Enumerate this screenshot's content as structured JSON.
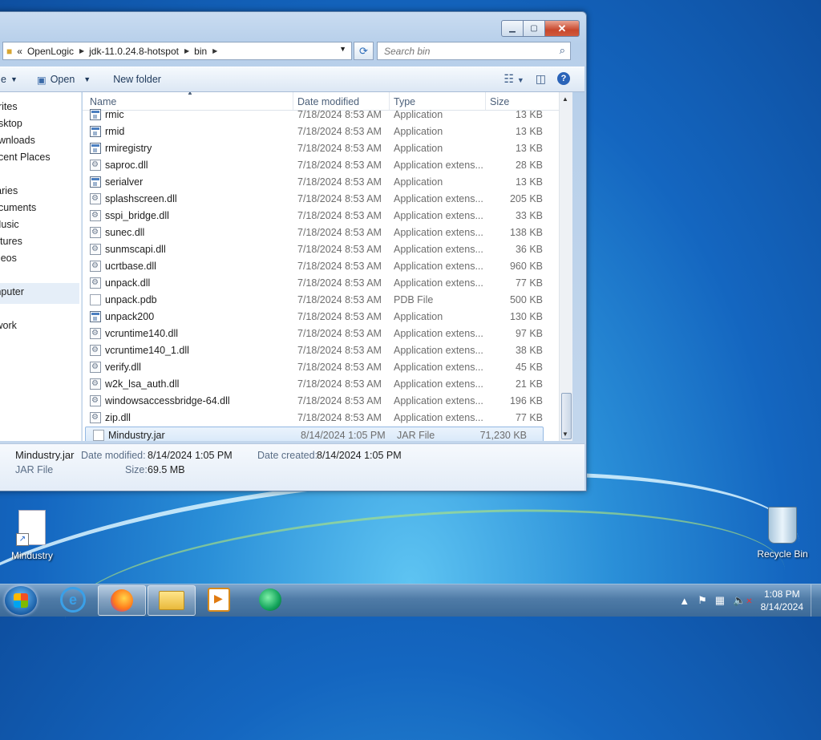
{
  "window": {
    "address": {
      "overflow": "«",
      "crumbs": [
        "OpenLogic",
        "jdk-11.0.24.8-hotspot",
        "bin"
      ]
    },
    "search_placeholder": "Search bin",
    "toolbar": {
      "open": "Open",
      "new_folder": "New folder",
      "partial_left": "e"
    },
    "nav": {
      "favorites": "orites",
      "desktop": "esktop",
      "downloads": "ownloads",
      "recent": "ecent Places",
      "libraries": "raries",
      "documents": "ocuments",
      "music": "Music",
      "pictures": "ictures",
      "videos": "ideos",
      "computer": "mputer",
      "network": "twork"
    },
    "columns": {
      "name": "Name",
      "date": "Date modified",
      "type": "Type",
      "size": "Size"
    },
    "files": [
      {
        "name": "rmic",
        "date": "7/18/2024 8:53 AM",
        "type": "Application",
        "size": "13 KB",
        "icon": "app"
      },
      {
        "name": "rmid",
        "date": "7/18/2024 8:53 AM",
        "type": "Application",
        "size": "13 KB",
        "icon": "app"
      },
      {
        "name": "rmiregistry",
        "date": "7/18/2024 8:53 AM",
        "type": "Application",
        "size": "13 KB",
        "icon": "app"
      },
      {
        "name": "saproc.dll",
        "date": "7/18/2024 8:53 AM",
        "type": "Application extens...",
        "size": "28 KB",
        "icon": "dll"
      },
      {
        "name": "serialver",
        "date": "7/18/2024 8:53 AM",
        "type": "Application",
        "size": "13 KB",
        "icon": "app"
      },
      {
        "name": "splashscreen.dll",
        "date": "7/18/2024 8:53 AM",
        "type": "Application extens...",
        "size": "205 KB",
        "icon": "dll"
      },
      {
        "name": "sspi_bridge.dll",
        "date": "7/18/2024 8:53 AM",
        "type": "Application extens...",
        "size": "33 KB",
        "icon": "dll"
      },
      {
        "name": "sunec.dll",
        "date": "7/18/2024 8:53 AM",
        "type": "Application extens...",
        "size": "138 KB",
        "icon": "dll"
      },
      {
        "name": "sunmscapi.dll",
        "date": "7/18/2024 8:53 AM",
        "type": "Application extens...",
        "size": "36 KB",
        "icon": "dll"
      },
      {
        "name": "ucrtbase.dll",
        "date": "7/18/2024 8:53 AM",
        "type": "Application extens...",
        "size": "960 KB",
        "icon": "dll"
      },
      {
        "name": "unpack.dll",
        "date": "7/18/2024 8:53 AM",
        "type": "Application extens...",
        "size": "77 KB",
        "icon": "dll"
      },
      {
        "name": "unpack.pdb",
        "date": "7/18/2024 8:53 AM",
        "type": "PDB File",
        "size": "500 KB",
        "icon": "doc"
      },
      {
        "name": "unpack200",
        "date": "7/18/2024 8:53 AM",
        "type": "Application",
        "size": "130 KB",
        "icon": "app"
      },
      {
        "name": "vcruntime140.dll",
        "date": "7/18/2024 8:53 AM",
        "type": "Application extens...",
        "size": "97 KB",
        "icon": "dll"
      },
      {
        "name": "vcruntime140_1.dll",
        "date": "7/18/2024 8:53 AM",
        "type": "Application extens...",
        "size": "38 KB",
        "icon": "dll"
      },
      {
        "name": "verify.dll",
        "date": "7/18/2024 8:53 AM",
        "type": "Application extens...",
        "size": "45 KB",
        "icon": "dll"
      },
      {
        "name": "w2k_lsa_auth.dll",
        "date": "7/18/2024 8:53 AM",
        "type": "Application extens...",
        "size": "21 KB",
        "icon": "dll"
      },
      {
        "name": "windowsaccessbridge-64.dll",
        "date": "7/18/2024 8:53 AM",
        "type": "Application extens...",
        "size": "196 KB",
        "icon": "dll"
      },
      {
        "name": "zip.dll",
        "date": "7/18/2024 8:53 AM",
        "type": "Application extens...",
        "size": "77 KB",
        "icon": "dll"
      },
      {
        "name": "Mindustry.jar",
        "date": "8/14/2024 1:05 PM",
        "type": "JAR File",
        "size": "71,230 KB",
        "icon": "doc",
        "selected": true
      }
    ],
    "details": {
      "filename": "Mindustry.jar",
      "filetype": "JAR File",
      "date_modified_label": "Date modified:",
      "date_modified": "8/14/2024 1:05 PM",
      "date_created_label": "Date created:",
      "date_created": "8/14/2024 1:05 PM",
      "size_label": "Size:",
      "size": "69.5 MB"
    }
  },
  "desktop": {
    "mindustry_label": "Mindustry",
    "recycle_label": "Recycle Bin"
  },
  "taskbar": {
    "time": "1:08 PM",
    "date": "8/14/2024"
  }
}
